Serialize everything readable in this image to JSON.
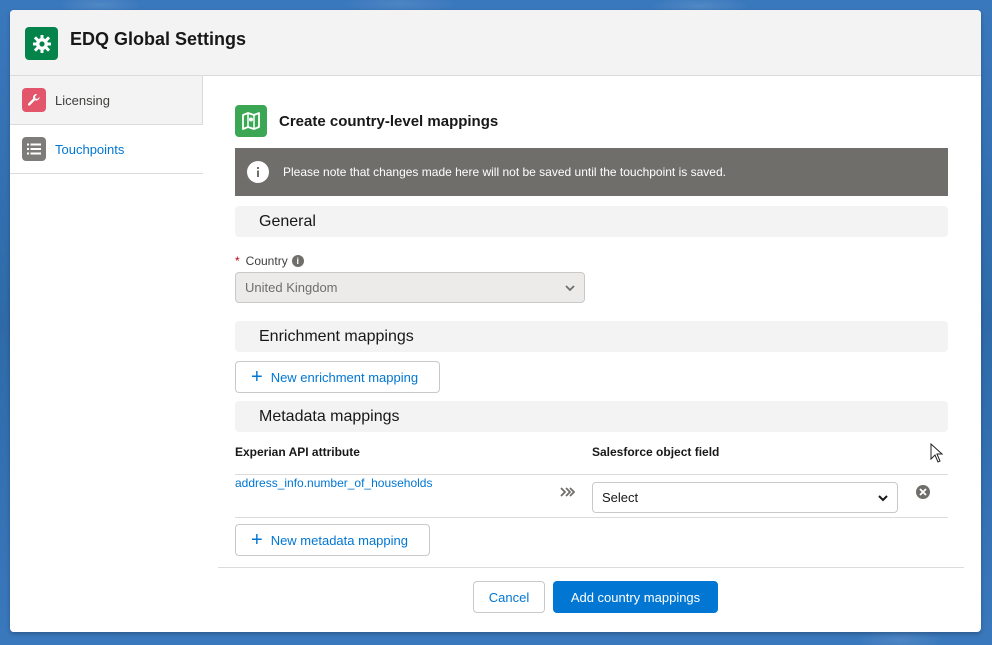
{
  "window": {
    "title": "EDQ Global Settings"
  },
  "sidebar": {
    "items": [
      {
        "label": "Licensing",
        "icon": "wrench-icon",
        "color": "#e3556b"
      },
      {
        "label": "Touchpoints",
        "icon": "list-icon",
        "color": "#7e7c7a"
      }
    ]
  },
  "section": {
    "title": "Create country-level mappings",
    "icon": "map-icon",
    "notice": "Please note that changes made here will not be saved until the touchpoint is saved."
  },
  "general": {
    "heading": "General",
    "country_label": "Country",
    "required_mark": "*",
    "country_value": "United Kingdom"
  },
  "enrichment": {
    "heading": "Enrichment mappings",
    "new_button": "New enrichment mapping"
  },
  "metadata": {
    "heading": "Metadata mappings",
    "columns": [
      "Experian API attribute",
      "Salesforce object field"
    ],
    "rows": [
      {
        "attribute": "address_info.number_of_households",
        "field": "Select"
      }
    ],
    "new_button": "New metadata mapping"
  },
  "footer": {
    "cancel": "Cancel",
    "submit": "Add country mappings"
  },
  "colors": {
    "brand": "#0176d3",
    "app_icon": "#04844b",
    "section_icon": "#3ba755",
    "notice_bg": "#706e6b"
  }
}
